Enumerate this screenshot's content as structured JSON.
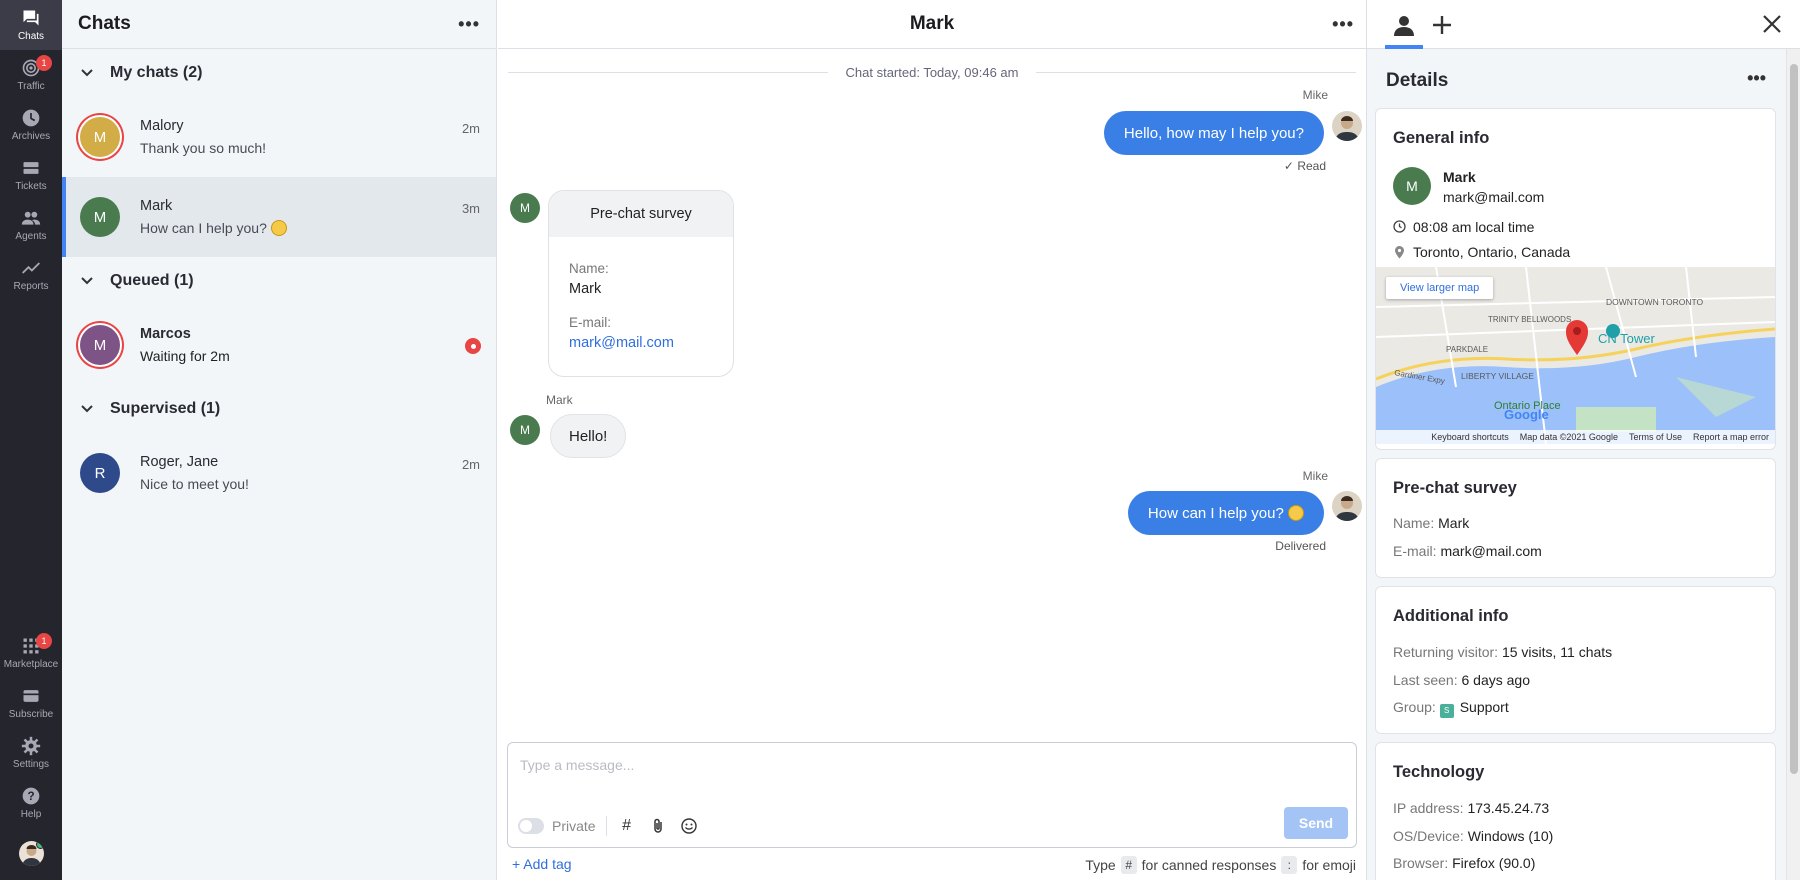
{
  "nav": {
    "items": [
      {
        "label": "Chats",
        "icon": "chat-bubble-icon"
      },
      {
        "label": "Traffic",
        "icon": "traffic-icon",
        "badge": "1"
      },
      {
        "label": "Archives",
        "icon": "clock-icon"
      },
      {
        "label": "Tickets",
        "icon": "ticket-icon"
      },
      {
        "label": "Agents",
        "icon": "agents-icon"
      },
      {
        "label": "Reports",
        "icon": "chart-line-icon"
      }
    ],
    "bottom": [
      {
        "label": "Marketplace",
        "icon": "grid-icon",
        "badge": "1"
      },
      {
        "label": "Subscribe",
        "icon": "card-icon"
      },
      {
        "label": "Settings",
        "icon": "gear-icon"
      },
      {
        "label": "Help",
        "icon": "help-icon"
      }
    ]
  },
  "list": {
    "title": "Chats",
    "sections": {
      "my_chats": "My chats (2)",
      "queued": "Queued (1)",
      "supervised": "Supervised (1)"
    },
    "chats": [
      {
        "initial": "M",
        "name": "Malory",
        "preview": "Thank you so much!",
        "time": "2m",
        "color": "#d1ac47"
      },
      {
        "initial": "M",
        "name": "Mark",
        "preview": "How can I help you?",
        "time": "3m",
        "color": "#4a7b4f"
      },
      {
        "initial": "M",
        "name": "Marcos",
        "preview": "Waiting for 2m",
        "time": "",
        "color": "#7d5485"
      },
      {
        "initial": "R",
        "name": "Roger, Jane",
        "preview": "Nice to meet you!",
        "time": "2m",
        "color": "#2e4a8a"
      }
    ]
  },
  "conversation": {
    "title": "Mark",
    "started": "Chat started: Today, 09:46 am",
    "messages": [
      {
        "author": "Mike",
        "text": "Hello, how may I help you?",
        "status": "Read"
      },
      {
        "survey_title": "Pre-chat survey",
        "name_label": "Name:",
        "name_value": "Mark",
        "email_label": "E-mail:",
        "email_value": "mark@mail.com"
      },
      {
        "author": "Mark",
        "text": "Hello!"
      },
      {
        "author": "Mike",
        "text": "How can I help you?",
        "status": "Delivered"
      }
    ],
    "visitor_initial": "M",
    "composer": {
      "placeholder": "Type a message...",
      "private_label": "Private",
      "send_label": "Send",
      "add_tag": "+ Add tag",
      "hint_type": "Type",
      "hint_key1": "#",
      "hint_canned": "for canned responses",
      "hint_key2": ":",
      "hint_emoji": "for emoji"
    }
  },
  "details": {
    "title": "Details",
    "general": {
      "title": "General info",
      "initial": "M",
      "name": "Mark",
      "email": "mark@mail.com",
      "local_time": "08:08 am local time",
      "location": "Toronto, Ontario, Canada",
      "map_link": "View larger map",
      "map_labels": [
        "DOWNTOWN TORONTO",
        "TRINITY BELLWOODS",
        "CN Tower",
        "PARKDALE",
        "LIBERTY VILLAGE",
        "Gardiner Expy",
        "Ontario Place",
        "Google"
      ],
      "map_footer": [
        "Keyboard shortcuts",
        "Map data ©2021 Google",
        "Terms of Use",
        "Report a map error"
      ]
    },
    "survey": {
      "title": "Pre-chat survey",
      "name_label": "Name:",
      "name_value": "Mark",
      "email_label": "E-mail:",
      "email_value": "mark@mail.com"
    },
    "additional": {
      "title": "Additional info",
      "returning_label": "Returning visitor:",
      "returning_value": "15 visits, 11 chats",
      "seen_label": "Last seen:",
      "seen_value": "6 days ago",
      "group_label": "Group:",
      "group_tag": "S",
      "group_value": "Support"
    },
    "technology": {
      "title": "Technology",
      "ip_label": "IP address:",
      "ip_value": "173.45.24.73",
      "os_label": "OS/Device:",
      "os_value": "Windows (10)",
      "browser_label": "Browser:",
      "browser_value": "Firefox (90.0)"
    }
  },
  "colors": {
    "accent": "#4384f5",
    "bubble": "#3a7fe5",
    "alert": "#e84545"
  }
}
